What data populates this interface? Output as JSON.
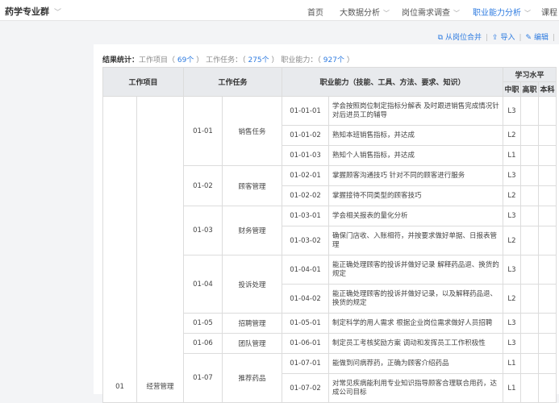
{
  "header": {
    "brand": "药学专业群",
    "nav": [
      "首页",
      "大数据分析",
      "岗位需求调查",
      "职业能力分析",
      "课程"
    ]
  },
  "toolbar": {
    "merge": "从岗位合并",
    "import": "导入",
    "edit": "编辑"
  },
  "summary": {
    "label": "结果统计：",
    "project_label": "工作项目",
    "project_count": "69个",
    "task_label": "工作任务：",
    "task_count": "275个",
    "ability_label": "职业能力：",
    "ability_count": "927个"
  },
  "table": {
    "headers": {
      "project": "工作项目",
      "task": "工作任务",
      "ability": "职业能力（技能、工具、方法、要求、知识）",
      "level": "学习水平",
      "levels": [
        "中职",
        "高职",
        "本科"
      ]
    },
    "project": {
      "code": "01",
      "name": "经营管理"
    },
    "tasks": [
      {
        "code": "01-01",
        "name": "销售任务",
        "abilities": [
          {
            "code": "01-01-01",
            "text": "学会按照岗位制定指标分解表 及时跟进销售完成情况针对后进员工的辅导",
            "level": "L3"
          },
          {
            "code": "01-01-02",
            "text": "熟知本班销售指标，并达成",
            "level": "L2"
          },
          {
            "code": "01-01-03",
            "text": "熟知个人销售指标，并达成",
            "level": "L1"
          }
        ]
      },
      {
        "code": "01-02",
        "name": "顾客管理",
        "abilities": [
          {
            "code": "01-02-01",
            "text": "掌握顾客沟通技巧 针对不同的顾客进行服务",
            "level": "L3"
          },
          {
            "code": "01-02-02",
            "text": "掌握接待不同类型的顾客技巧",
            "level": "L2"
          }
        ]
      },
      {
        "code": "01-03",
        "name": "财务管理",
        "abilities": [
          {
            "code": "01-03-01",
            "text": "学会相关报表的量化分析",
            "level": "L3"
          },
          {
            "code": "01-03-02",
            "text": "确保门店收、入账相符，并按要求做好单据、日报表管理",
            "level": "L2"
          }
        ]
      },
      {
        "code": "01-04",
        "name": "投诉处理",
        "abilities": [
          {
            "code": "01-04-01",
            "text": "能正确处理顾客的投诉并做好记录 解释药品退、换货的规定",
            "level": "L3"
          },
          {
            "code": "01-04-02",
            "text": "能正确处理顾客的投诉并做好记录，以及解释药品退、换货的规定",
            "level": "L2"
          }
        ]
      },
      {
        "code": "01-05",
        "name": "招聘管理",
        "abilities": [
          {
            "code": "01-05-01",
            "text": "制定科学的用人需求 根据企业岗位需求做好人员招聘",
            "level": "L3"
          }
        ]
      },
      {
        "code": "01-06",
        "name": "团队管理",
        "abilities": [
          {
            "code": "01-06-01",
            "text": "制定员工考核奖励方案 调动和发挥员工工作积极性",
            "level": "L3"
          }
        ]
      },
      {
        "code": "01-07",
        "name": "推荐药品",
        "abilities": [
          {
            "code": "01-07-01",
            "text": "能做到问病荐药，正确为顾客介绍药品",
            "level": "L1"
          },
          {
            "code": "01-07-02",
            "text": "对常见疾病能利用专业知识指导顾客合理联合用药，达成公司目标",
            "level": "L1"
          }
        ]
      }
    ]
  }
}
